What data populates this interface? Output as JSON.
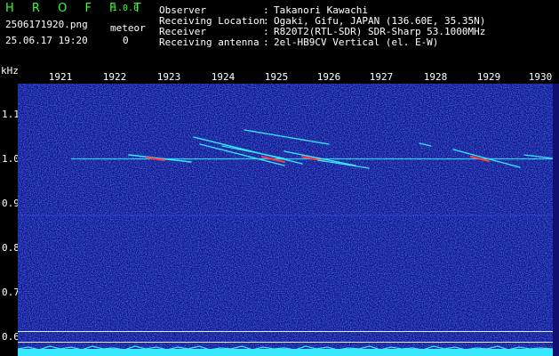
{
  "header": {
    "app_title": "H R O F F T",
    "version": "1.0.0",
    "filename": "2506171920.png",
    "datetime": "25.06.17 19:20",
    "meteor_label": "meteor",
    "meteor_count": "0"
  },
  "info": [
    {
      "label": "Observer",
      "value": "Takanori Kawachi"
    },
    {
      "label": "Receiving Location",
      "value": "Ogaki, Gifu, JAPAN (136.60E, 35.35N)"
    },
    {
      "label": "Receiver",
      "value": "R820T2(RTL-SDR) SDR-Sharp 53.1000MHz"
    },
    {
      "label": "Receiving antenna",
      "value": "2el-HB9CV Vertical (el. E-W)"
    }
  ],
  "info_separator": ":",
  "axes": {
    "y_unit": "kHz",
    "x_ticks": [
      "1921",
      "1922",
      "1923",
      "1924",
      "1925",
      "1926",
      "1927",
      "1928",
      "1929",
      "1930"
    ],
    "y_ticks": [
      "1.1",
      "1.0",
      "0.9",
      "0.8",
      "0.7",
      "0.6"
    ]
  },
  "colors": {
    "background": "#000000",
    "spectrum_bg": "#0b0f8e",
    "title_green": "#35ff35",
    "trace_cyan": "#37e8ff",
    "hot": "#ff3b3b"
  }
}
